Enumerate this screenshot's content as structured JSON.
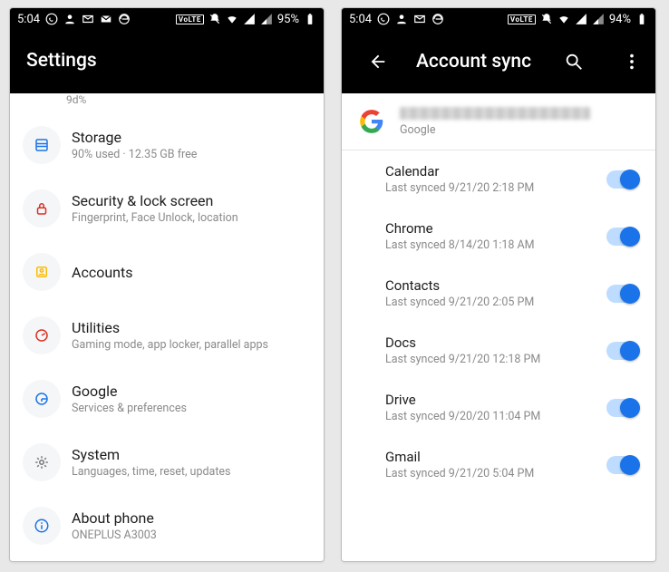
{
  "left": {
    "statusbar": {
      "time": "5:04",
      "battery": "95%"
    },
    "title": "Settings",
    "cutoff_subtitle": "9d%",
    "items": [
      {
        "icon": "storage-icon",
        "title": "Storage",
        "subtitle": "90% used · 12.35 GB free"
      },
      {
        "icon": "lock-icon",
        "title": "Security & lock screen",
        "subtitle": "Fingerprint, Face Unlock, location"
      },
      {
        "icon": "accounts-icon",
        "title": "Accounts",
        "subtitle": ""
      },
      {
        "icon": "utilities-icon",
        "title": "Utilities",
        "subtitle": "Gaming mode, app locker, parallel apps"
      },
      {
        "icon": "google-icon",
        "title": "Google",
        "subtitle": "Services & preferences"
      },
      {
        "icon": "gear-icon",
        "title": "System",
        "subtitle": "Languages, time, reset, updates"
      },
      {
        "icon": "info-icon",
        "title": "About phone",
        "subtitle": "ONEPLUS A3003"
      }
    ]
  },
  "right": {
    "statusbar": {
      "time": "5:04",
      "battery": "94%"
    },
    "title": "Account sync",
    "account": {
      "provider": "Google"
    },
    "items": [
      {
        "title": "Calendar",
        "subtitle": "Last synced 9/21/20 2:18 PM",
        "on": true
      },
      {
        "title": "Chrome",
        "subtitle": "Last synced 8/14/20 1:18 AM",
        "on": true
      },
      {
        "title": "Contacts",
        "subtitle": "Last synced 9/21/20 2:05 PM",
        "on": true
      },
      {
        "title": "Docs",
        "subtitle": "Last synced 9/21/20 12:18 PM",
        "on": true
      },
      {
        "title": "Drive",
        "subtitle": "Last synced 9/20/20 11:04 PM",
        "on": true
      },
      {
        "title": "Gmail",
        "subtitle": "Last synced 9/21/20 5:04 PM",
        "on": true
      }
    ]
  }
}
